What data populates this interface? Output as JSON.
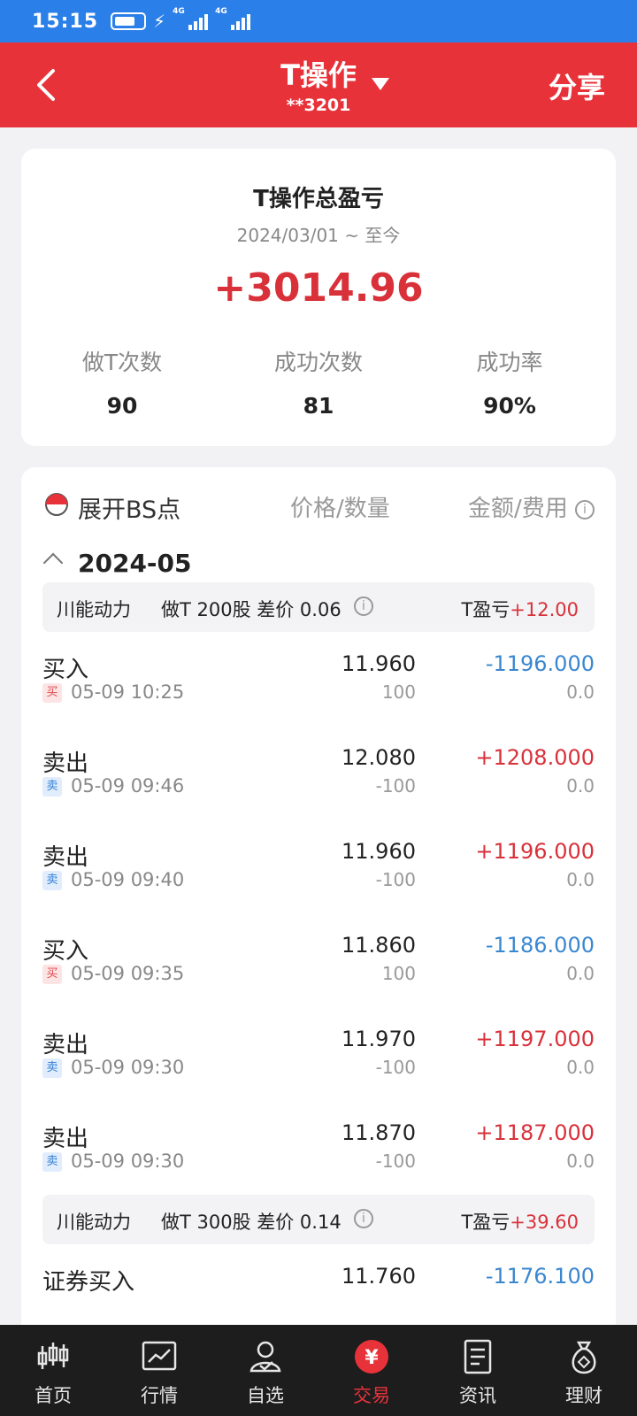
{
  "status_bar": {
    "time": "15:15",
    "net1": "4G",
    "net2": "4G"
  },
  "header": {
    "title": "T操作",
    "account": "**3201",
    "share": "分享"
  },
  "summary": {
    "title": "T操作总盈亏",
    "date_range": "2024/03/01 ~ 至今",
    "total": "+3014.96",
    "stats": [
      {
        "label": "做T次数",
        "value": "90"
      },
      {
        "label": "成功次数",
        "value": "81"
      },
      {
        "label": "成功率",
        "value": "90%"
      }
    ]
  },
  "detail": {
    "expand_label": "展开BS点",
    "col_price": "价格/数量",
    "col_amount": "金额/费用",
    "month": "2024-05",
    "groups": [
      {
        "name": "川能动力",
        "desc": "做T 200股 差价 0.06",
        "pl_label": "T盈亏",
        "pl_value": "+12.00"
      },
      {
        "name": "川能动力",
        "desc": "做T 300股 差价 0.14",
        "pl_label": "T盈亏",
        "pl_value": "+39.60"
      }
    ],
    "trades": [
      {
        "action": "买入",
        "badge": "买",
        "time": "05-09 10:25",
        "price": "11.960",
        "qty": "100",
        "amount": "-1196.000",
        "fee": "0.0"
      },
      {
        "action": "卖出",
        "badge": "卖",
        "time": "05-09 09:46",
        "price": "12.080",
        "qty": "-100",
        "amount": "+1208.000",
        "fee": "0.0"
      },
      {
        "action": "卖出",
        "badge": "卖",
        "time": "05-09 09:40",
        "price": "11.960",
        "qty": "-100",
        "amount": "+1196.000",
        "fee": "0.0"
      },
      {
        "action": "买入",
        "badge": "买",
        "time": "05-09 09:35",
        "price": "11.860",
        "qty": "100",
        "amount": "-1186.000",
        "fee": "0.0"
      },
      {
        "action": "卖出",
        "badge": "卖",
        "time": "05-09 09:30",
        "price": "11.970",
        "qty": "-100",
        "amount": "+1197.000",
        "fee": "0.0"
      },
      {
        "action": "卖出",
        "badge": "卖",
        "time": "05-09 09:30",
        "price": "11.870",
        "qty": "-100",
        "amount": "+1187.000",
        "fee": "0.0"
      },
      {
        "action": "证券买入",
        "badge": "",
        "time": "",
        "price": "11.760",
        "qty": "",
        "amount": "-1176.100",
        "fee": ""
      }
    ]
  },
  "tabs": [
    {
      "label": "首页",
      "icon": "candlestick-icon"
    },
    {
      "label": "行情",
      "icon": "chart-icon"
    },
    {
      "label": "自选",
      "icon": "person-check-icon"
    },
    {
      "label": "交易",
      "icon": "yuan-icon"
    },
    {
      "label": "资讯",
      "icon": "document-icon"
    },
    {
      "label": "理财",
      "icon": "money-bag-icon"
    }
  ],
  "colors": {
    "header_red": "#e8323a",
    "status_blue": "#2b7fe8",
    "positive": "#d9313a",
    "negative": "#3a87d0"
  }
}
